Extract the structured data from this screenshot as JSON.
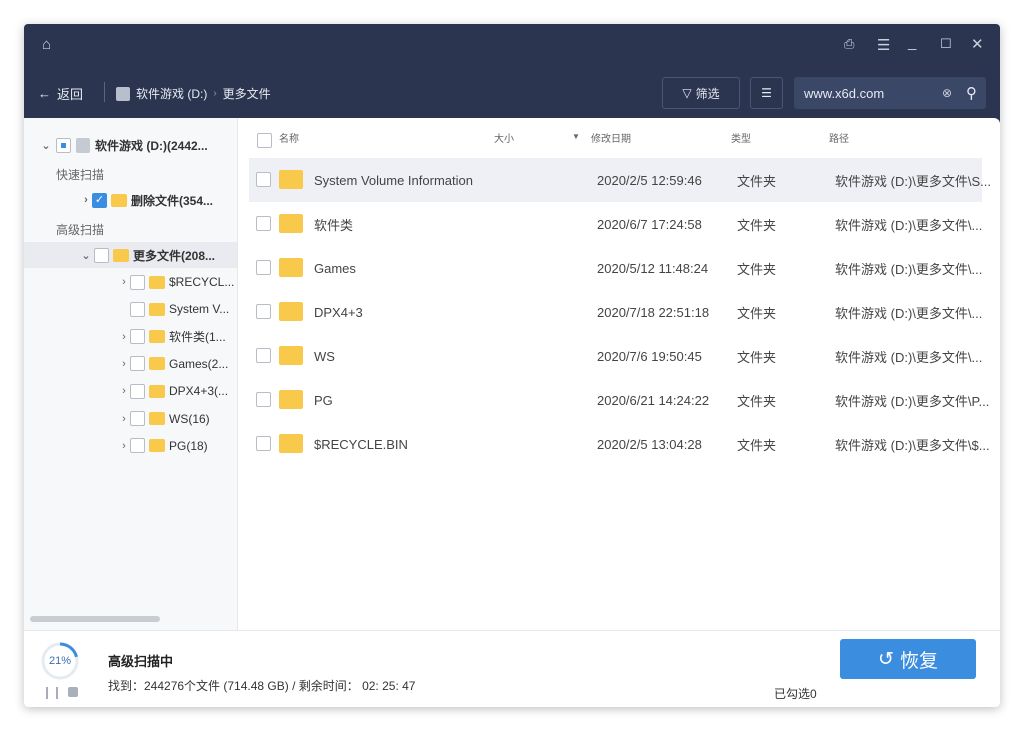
{
  "header": {
    "back_label": "返回",
    "breadcrumb": [
      "软件游戏 (D:)",
      "更多文件"
    ],
    "filter_label": "筛选",
    "search_value": "www.x6d.com"
  },
  "sidebar": {
    "root": "软件游戏 (D:)(2442...",
    "quick_scan": "快速扫描",
    "deleted": "删除文件(354...",
    "advanced_scan": "高级扫描",
    "more_files": "更多文件(208...",
    "children": [
      "$RECYCL...",
      "System V...",
      "软件类(1...",
      "Games(2...",
      "DPX4+3(...",
      "WS(16)",
      "PG(18)"
    ]
  },
  "columns": {
    "name": "名称",
    "size": "大小",
    "date": "修改日期",
    "type": "类型",
    "path": "路径"
  },
  "rows": [
    {
      "name": "System Volume Information",
      "date": "2020/2/5 12:59:46",
      "type": "文件夹",
      "path": "软件游戏 (D:)\\更多文件\\S..."
    },
    {
      "name": "软件类",
      "date": "2020/6/7 17:24:58",
      "type": "文件夹",
      "path": "软件游戏 (D:)\\更多文件\\..."
    },
    {
      "name": "Games",
      "date": "2020/5/12 11:48:24",
      "type": "文件夹",
      "path": "软件游戏 (D:)\\更多文件\\..."
    },
    {
      "name": "DPX4+3",
      "date": "2020/7/18 22:51:18",
      "type": "文件夹",
      "path": "软件游戏 (D:)\\更多文件\\..."
    },
    {
      "name": "WS",
      "date": "2020/7/6 19:50:45",
      "type": "文件夹",
      "path": "软件游戏 (D:)\\更多文件\\..."
    },
    {
      "name": "PG",
      "date": "2020/6/21 14:24:22",
      "type": "文件夹",
      "path": "软件游戏 (D:)\\更多文件\\P..."
    },
    {
      "name": "$RECYCLE.BIN",
      "date": "2020/2/5 13:04:28",
      "type": "文件夹",
      "path": "软件游戏 (D:)\\更多文件\\$..."
    }
  ],
  "footer": {
    "progress_percent": 21,
    "progress_label": "21%",
    "status": "高级扫描中",
    "found": "找到：244276个文件 (714.48 GB) / 剩余时间： 02: 25: 47",
    "selected": "已勾选0",
    "recover_label": "恢复"
  },
  "colors": {
    "header": "#2b3550",
    "accent": "#3b8de0",
    "folder": "#f8c94a"
  }
}
